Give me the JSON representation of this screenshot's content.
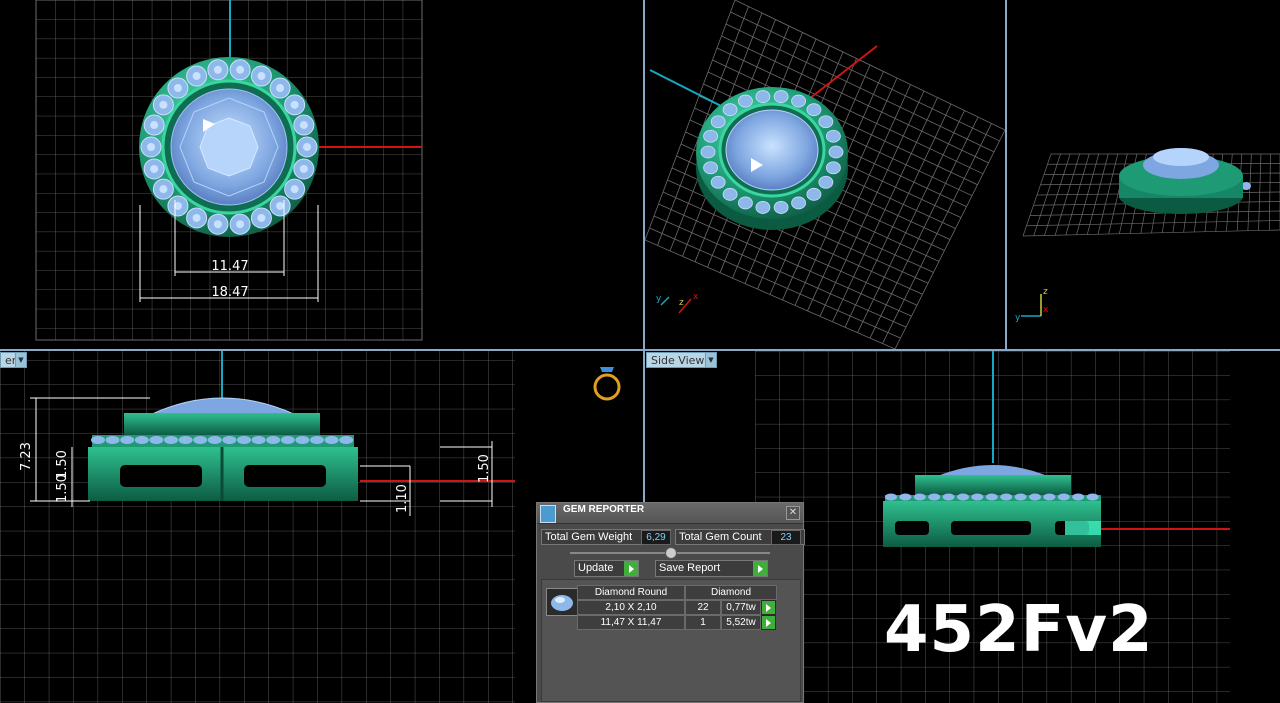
{
  "viewports": {
    "top": {
      "dim_inner": "11.47",
      "dim_outer": "18.47"
    },
    "front": {
      "tab_label": "er",
      "dim_height": "7.23",
      "dim_left_a": "1.50",
      "dim_left_b": "1.50",
      "dim_mid": "1.10",
      "dim_right": "1.50"
    },
    "side": {
      "tab_label": "Side View"
    }
  },
  "axes": {
    "x": "x",
    "y": "y",
    "z": "z"
  },
  "model_code": "452Fv2",
  "gem_reporter": {
    "title": "GEM REPORTER",
    "total_weight_label": "Total Gem Weight",
    "total_weight_value": "6,29",
    "total_count_label": "Total Gem Count",
    "total_count_value": "23",
    "update_label": "Update",
    "save_label": "Save Report",
    "table": {
      "shape": "Diamond Round",
      "material": "Diamond",
      "rows": [
        {
          "size": "2,10 X 2,10",
          "count": "22",
          "weight": "0,77tw"
        },
        {
          "size": "11,47 X 11,47",
          "count": "1",
          "weight": "5,52tw"
        }
      ]
    }
  },
  "colors": {
    "metal": "#1e9a74",
    "gem": "#8fb8ea",
    "grid": "#6b6b6b",
    "axis_x": "#d01414",
    "axis_y": "#18a8c0"
  }
}
